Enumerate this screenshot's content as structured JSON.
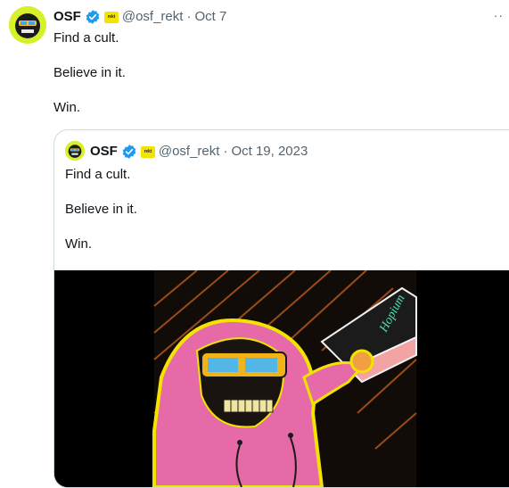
{
  "tweet": {
    "author_name": "OSF",
    "handle": "@osf_rekt",
    "separator": "·",
    "date": "Oct 7",
    "affiliate_badge_text": "rekt",
    "lines": [
      "Find a cult.",
      "Believe in it.",
      "Win."
    ],
    "more_label": "··"
  },
  "quoted": {
    "author_name": "OSF",
    "handle": "@osf_rekt",
    "separator": "·",
    "date": "Oct 19, 2023",
    "affiliate_badge_text": "rekt",
    "lines": [
      "Find a cult.",
      "Believe in it.",
      "Win."
    ],
    "media": {
      "bottle_text": "Hopium",
      "icon": "artwork-image"
    }
  },
  "colors": {
    "verified": "#1d9bf0",
    "muted": "#536471",
    "border": "#cfd9de",
    "affiliate": "#f3e300"
  }
}
